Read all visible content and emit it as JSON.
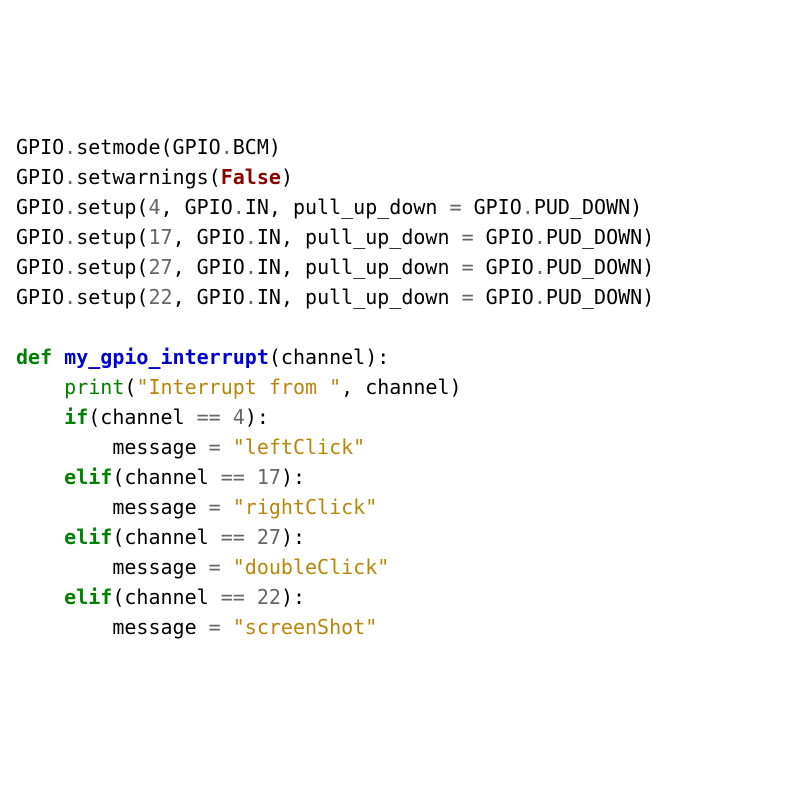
{
  "code": {
    "l1_a": "GPIO",
    "l1_b": "setmode(GPIO",
    "l1_c": "BCM)",
    "l2_a": "GPIO",
    "l2_b": "setwarnings(",
    "l2_false": "False",
    "l2_c": ")",
    "l3_a": "GPIO",
    "l3_b": "setup(",
    "l3_n": "4",
    "l3_c": ", GPIO",
    "l3_d": "IN, pull_up_down ",
    "l3_eq": "=",
    "l3_e": " GPIO",
    "l3_f": "PUD_DOWN)",
    "l4_a": "GPIO",
    "l4_b": "setup(",
    "l4_n": "17",
    "l4_c": ", GPIO",
    "l4_d": "IN, pull_up_down ",
    "l4_eq": "=",
    "l4_e": " GPIO",
    "l4_f": "PUD_DOWN)",
    "l5_a": "GPIO",
    "l5_b": "setup(",
    "l5_n": "27",
    "l5_c": ", GPIO",
    "l5_d": "IN, pull_up_down ",
    "l5_eq": "=",
    "l5_e": " GPIO",
    "l5_f": "PUD_DOWN)",
    "l6_a": "GPIO",
    "l6_b": "setup(",
    "l6_n": "22",
    "l6_c": ", GPIO",
    "l6_d": "IN, pull_up_down ",
    "l6_eq": "=",
    "l6_e": " GPIO",
    "l6_f": "PUD_DOWN)",
    "l8_def": "def",
    "l8_name": "my_gpio_interrupt",
    "l8_params": "(channel):",
    "l9_print": "print",
    "l9_open": "(",
    "l9_str": "\"Interrupt from \"",
    "l9_rest": ", channel)",
    "l10_if": "if",
    "l10_a": "(channel ",
    "l10_eq": "==",
    "l10_sp": " ",
    "l10_n": "4",
    "l10_b": "):",
    "l11_a": "message ",
    "l11_eq": "=",
    "l11_sp": " ",
    "l11_str": "\"leftClick\"",
    "l12_elif": "elif",
    "l12_a": "(channel ",
    "l12_eq": "==",
    "l12_sp": " ",
    "l12_n": "17",
    "l12_b": "):",
    "l13_a": "message ",
    "l13_eq": "=",
    "l13_sp": " ",
    "l13_str": "\"rightClick\"",
    "l14_elif": "elif",
    "l14_a": "(channel ",
    "l14_eq": "==",
    "l14_sp": " ",
    "l14_n": "27",
    "l14_b": "):",
    "l15_a": "message ",
    "l15_eq": "=",
    "l15_sp": " ",
    "l15_str": "\"doubleClick\"",
    "l16_elif": "elif",
    "l16_a": "(channel ",
    "l16_eq": "==",
    "l16_sp": " ",
    "l16_n": "22",
    "l16_b": "):",
    "l17_a": "message ",
    "l17_eq": "=",
    "l17_sp": " ",
    "l17_str": "\"screenShot\""
  }
}
